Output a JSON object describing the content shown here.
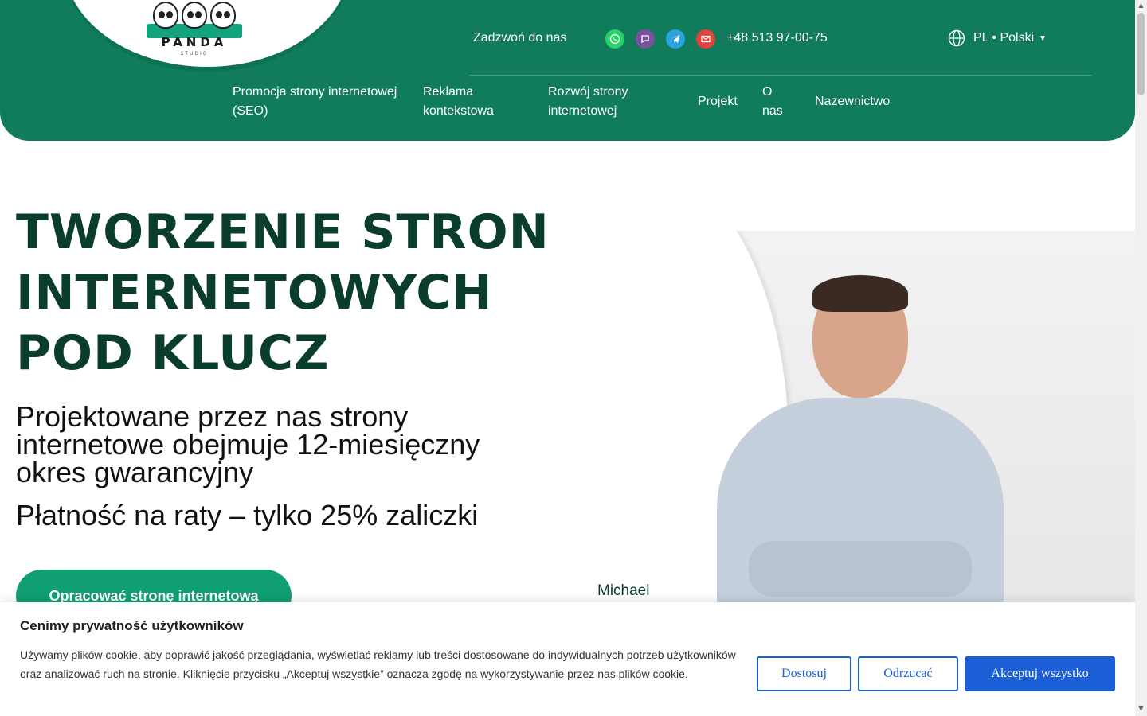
{
  "header": {
    "logo_text": "PANDA",
    "logo_sub": "STUDIO",
    "call_label": "Zadzwoń do nas",
    "phone": "+48 513 97-00-75",
    "language": "PL • Polski",
    "contact_icons": [
      "whatsapp-icon",
      "viber-icon",
      "telegram-icon",
      "mail-icon"
    ]
  },
  "nav": {
    "items": [
      {
        "label": "Promocja strony internetowej (SEO)"
      },
      {
        "label": "Reklama kontekstowa"
      },
      {
        "label": "Rozwój strony internetowej"
      },
      {
        "label": "Projekt"
      },
      {
        "label": "O nas"
      },
      {
        "label": "Nazewnictwo"
      }
    ]
  },
  "hero": {
    "title": "TWORZENIE STRON INTERNETOWYCH POD KLUCZ",
    "subtitle": "Projektowane przez nas strony internetowe obejmuje 12-miesięczny okres gwarancyjny",
    "payment": "Płatność na raty – tylko 25% zaliczki",
    "cta_label": "Opracować stronę internetową",
    "person_name": "Michael"
  },
  "cookie": {
    "title": "Cenimy prywatność użytkowników",
    "text": "Używamy plików cookie, aby poprawić jakość przeglądania, wyświetlać reklamy lub treści dostosowane do indywidualnych potrzeb użytkowników oraz analizować ruch na stronie. Kliknięcie przycisku „Akceptuj wszystkie” oznacza zgodę na wykorzystywanie przez nas plików cookie.",
    "customize_label": "Dostosuj",
    "reject_label": "Odrzucać",
    "accept_label": "Akceptuj wszystko"
  },
  "colors": {
    "brand_green": "#107c5c",
    "cta_green": "#109e75",
    "title_dark": "#0b3d2e",
    "cookie_blue": "#1b5ed6"
  }
}
